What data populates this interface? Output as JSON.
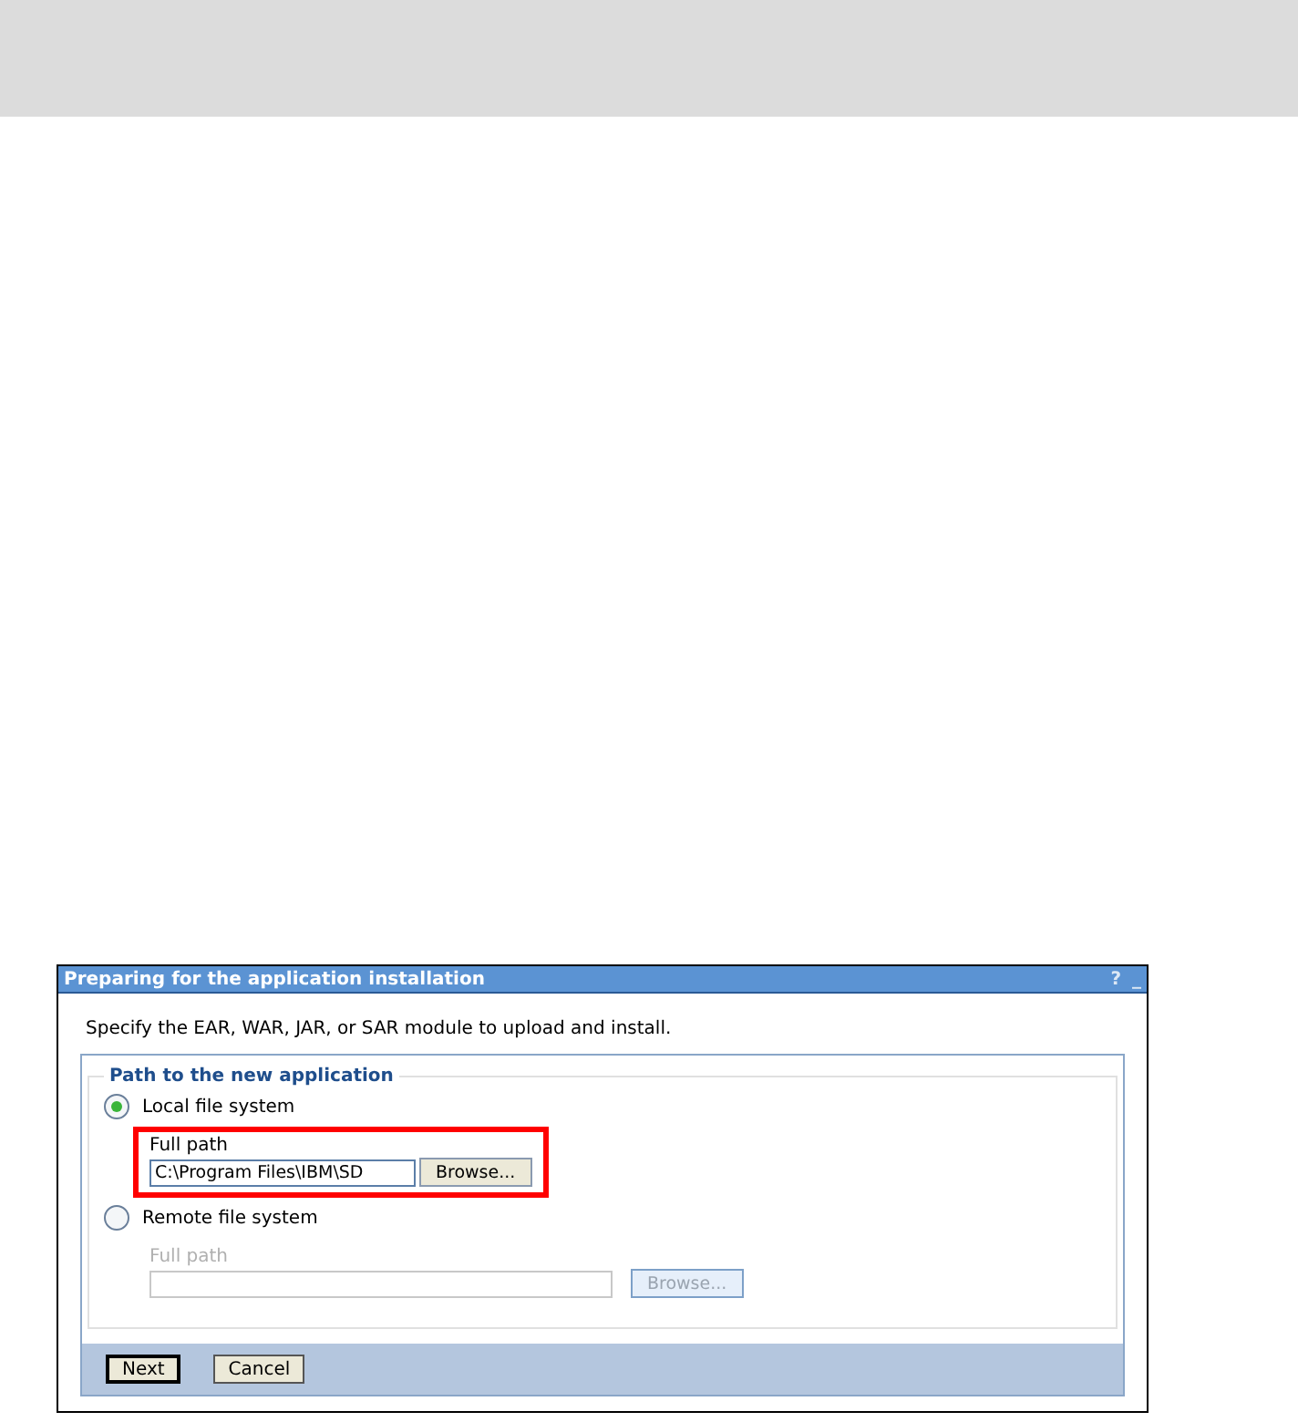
{
  "dialog": {
    "title": "Preparing for the application installation",
    "help": "?",
    "minimize": "_"
  },
  "instruction": "Specify the EAR, WAR, JAR, or SAR module to upload and install.",
  "group": {
    "legend": "Path to the new application",
    "options": [
      {
        "label": "Local file system",
        "selected": true,
        "disabled": false,
        "highlighted": true,
        "field_label": "Full path",
        "value": "C:\\Program Files\\IBM\\SD",
        "browse": "Browse..."
      },
      {
        "label": "Remote file system",
        "selected": false,
        "disabled": true,
        "highlighted": false,
        "field_label": "Full path",
        "browse": "Browse..."
      }
    ]
  },
  "buttons": [
    {
      "label": "Next",
      "default": true
    },
    {
      "label": "Cancel",
      "default": false
    }
  ]
}
